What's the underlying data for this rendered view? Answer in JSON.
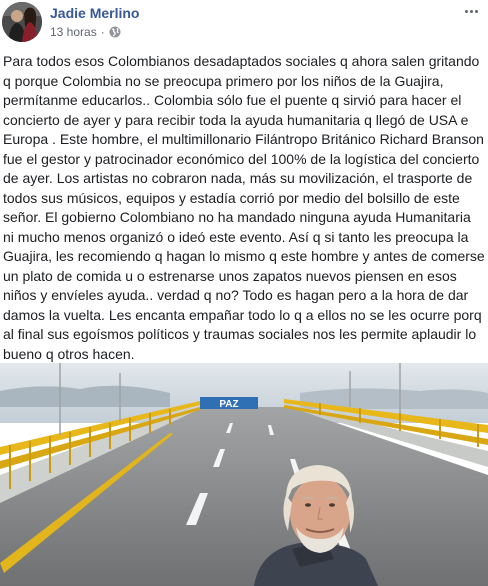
{
  "post": {
    "author": "Jadie Merlino",
    "timestamp": "13 horas",
    "separator": "·",
    "audience_icon": "globe-icon",
    "more_icon": "more-options-icon",
    "text": "Para todos esos Colombianos desadaptados sociales q ahora salen gritando q porque Colombia no se preocupa primero por los niños de la Guajira, permítanme educarlos.. Colombia sólo fue el puente q sirvió para hacer el concierto de ayer y para recibir toda la ayuda humanitaria q llegó de USA e Europa . Este hombre, el multimillonario Filántropo Británico Richard Branson fue el gestor y patrocinador económico del 100% de la logística del concierto de ayer. Los artistas no cobraron nada, más su movilización, el trasporte de todos sus músicos, equipos y estadía corrió por medio del bolsillo de este señor. El gobierno Colombiano no ha mandado ninguna ayuda Humanitaria ni mucho menos organizó o ideó este evento. Así q si tanto les preocupa la Guajira, les recomiendo q hagan lo mismo q este hombre y antes de comerse un plato de comida u o estrenarse unos zapatos nuevos piensen en esos niños y envíeles ayuda.. verdad q no? Todo es hagan pero a la hora de dar damos la vuelta. Les encanta empañar todo lo q a ellos no se les ocurre porq al final sus egoísmos políticos y traumas sociales nos les permite aplaudir lo bueno q otros hacen."
  },
  "photo": {
    "sign_text": "PAZ"
  },
  "colors": {
    "author_link": "#385898",
    "meta_text": "#616770",
    "body_text": "#1c1e21",
    "railing_yellow": "#e8b71a",
    "sky": "#cdd6dd",
    "road": "#7d7f80"
  }
}
